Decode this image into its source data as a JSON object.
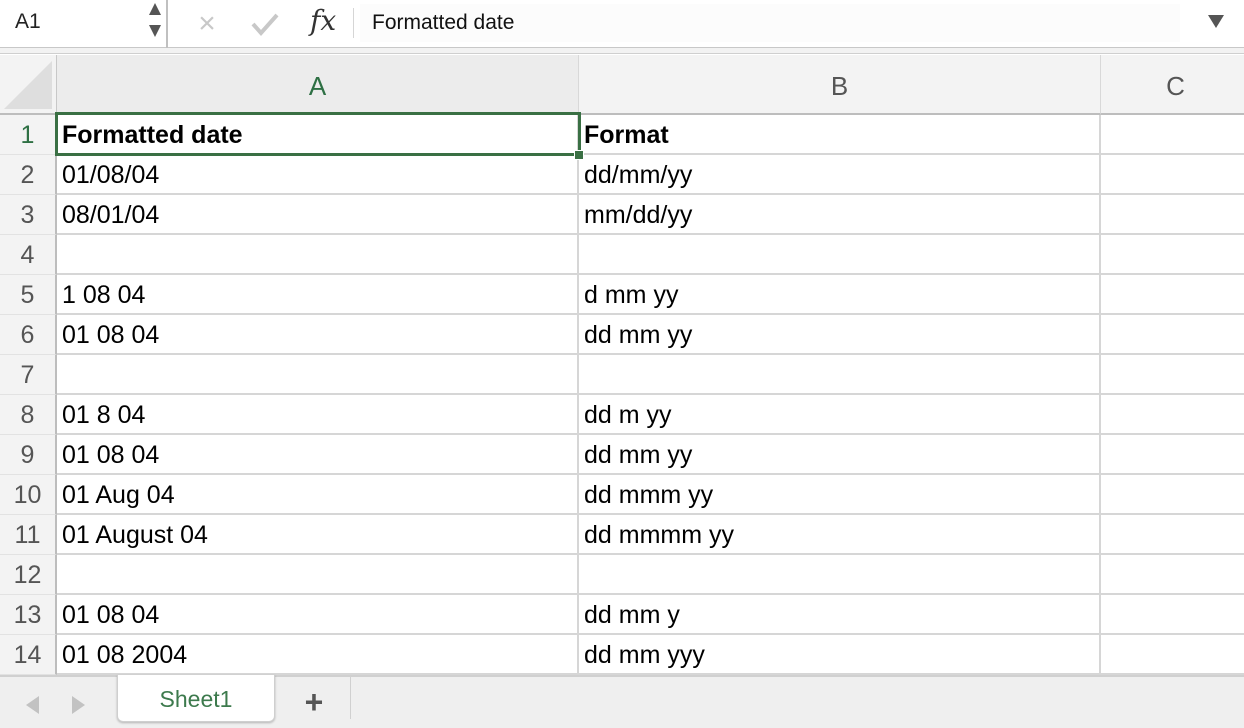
{
  "formula_bar": {
    "name_box": "A1",
    "cancel_icon": "×",
    "fx_label": "fx",
    "formula_value": "Formatted date"
  },
  "columns": [
    {
      "label": "A",
      "active": true
    },
    {
      "label": "B",
      "active": false
    },
    {
      "label": "C",
      "active": false
    }
  ],
  "rows": [
    {
      "num": "1",
      "a": "Formatted date",
      "b": "Format"
    },
    {
      "num": "2",
      "a": "01/08/04",
      "b": "dd/mm/yy"
    },
    {
      "num": "3",
      "a": "08/01/04",
      "b": "mm/dd/yy"
    },
    {
      "num": "4",
      "a": "",
      "b": ""
    },
    {
      "num": "5",
      "a": "1 08 04",
      "b": "d mm yy"
    },
    {
      "num": "6",
      "a": "01 08 04",
      "b": "dd mm yy"
    },
    {
      "num": "7",
      "a": "",
      "b": ""
    },
    {
      "num": "8",
      "a": "01 8 04",
      "b": "dd m yy"
    },
    {
      "num": "9",
      "a": "01 08 04",
      "b": "dd mm yy"
    },
    {
      "num": "10",
      "a": "01 Aug 04",
      "b": "dd mmm yy"
    },
    {
      "num": "11",
      "a": "01 August 04",
      "b": "dd mmmm yy"
    },
    {
      "num": "12",
      "a": "",
      "b": ""
    },
    {
      "num": "13",
      "a": "01 08 04",
      "b": "dd mm y"
    },
    {
      "num": "14",
      "a": "01 08 2004",
      "b": "dd mm yyy"
    }
  ],
  "selected_cell": "A1",
  "sheet_tabs": {
    "active": "Sheet1",
    "add_label": "+"
  },
  "colors": {
    "accent": "#3a7044",
    "tab_text": "#3d7a4d"
  }
}
